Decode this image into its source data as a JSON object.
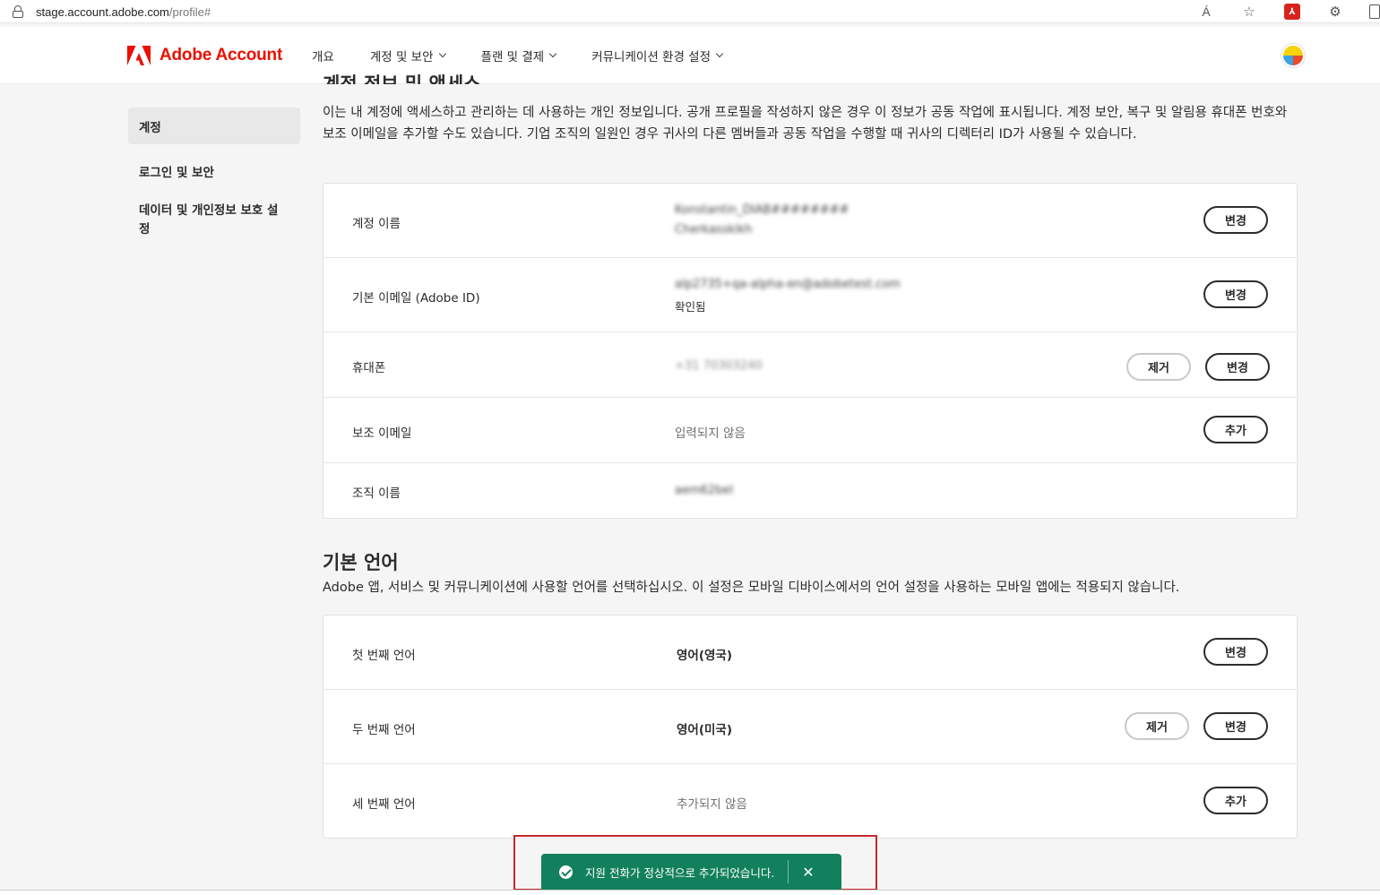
{
  "browser": {
    "url_host": "stage.account.adobe.com",
    "url_path": "/profile#",
    "read_aloud_label": "Á"
  },
  "header": {
    "logo_text": "Adobe Account",
    "nav": [
      {
        "label": "개요"
      },
      {
        "label": "계정 및 보안"
      },
      {
        "label": "플랜 및 결제"
      },
      {
        "label": "커뮤니케이션 환경 설정"
      }
    ]
  },
  "sidebar": {
    "items": [
      {
        "label": "계정"
      },
      {
        "label": "로그인 및 보안"
      },
      {
        "label": "데이터 및 개인정보 보호 설정"
      }
    ]
  },
  "account_section": {
    "title": "계정 정보 및 액세스",
    "description": "이는 내 계정에 액세스하고 관리하는 데 사용하는 개인 정보입니다. 공개 프로필을 작성하지 않은 경우 이 정보가 공동 작업에 표시됩니다. 계정 보안, 복구 및 알림용 휴대폰 번호와 보조 이메일을 추가할 수도 있습니다. 기업 조직의 일원인 경우 귀사의 다른 멤버들과 공동 작업을 수행할 때 귀사의 디렉터리 ID가 사용될 수 있습니다.",
    "rows": [
      {
        "label": "계정 이름",
        "value_line1": "Konstantin_DIAB########",
        "value_line2": "Cherkasskikh",
        "btn_change": "변경"
      },
      {
        "label": "기본 이메일 (Adobe ID)",
        "value_line1": "alp2735+qa-alpha-en@adobetest.com",
        "value_line2": "확인됨",
        "btn_change": "변경"
      },
      {
        "label": "휴대폰",
        "value_line1": "+31 70303240",
        "btn_remove": "제거",
        "btn_change": "변경"
      },
      {
        "label": "보조 이메일",
        "value_line1": "입력되지 않음",
        "btn_add": "추가"
      },
      {
        "label": "조직 이름",
        "value_line1": "aem62bel"
      }
    ]
  },
  "language_section": {
    "title": "기본 언어",
    "description": "Adobe 앱, 서비스 및 커뮤니케이션에 사용할 언어를 선택하십시오. 이 설정은 모바일 디바이스에서의 언어 설정을 사용하는 모바일 앱에는 적용되지 않습니다.",
    "rows": [
      {
        "label": "첫 번째 언어",
        "value": "영어(영국)",
        "btn_change": "변경"
      },
      {
        "label": "두 번째 언어",
        "value": "영어(미국)",
        "btn_remove": "제거",
        "btn_change": "변경"
      },
      {
        "label": "세 번째 언어",
        "value": "추가되지 않음",
        "btn_add": "추가"
      }
    ]
  },
  "toast": {
    "message": "지원 전화가 정상적으로 추가되었습니다.",
    "close_glyph": "✕",
    "color": "#12805c"
  },
  "colors": {
    "brand": "#eb1000",
    "highlight_outline": "#c4262e"
  }
}
